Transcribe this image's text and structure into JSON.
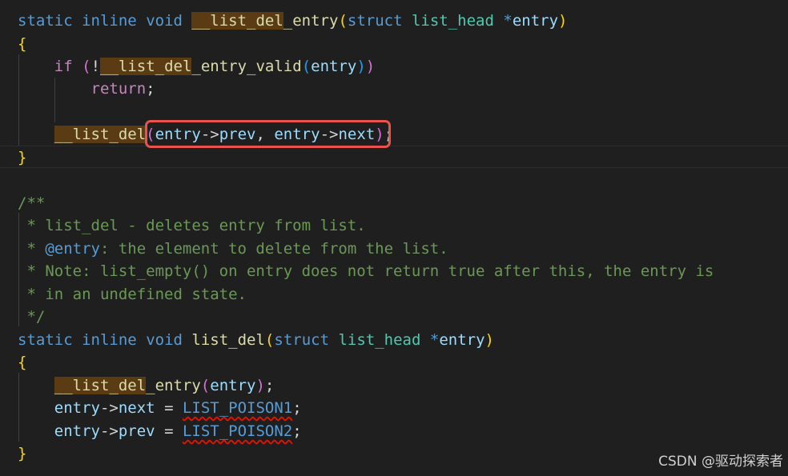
{
  "code": {
    "fn1": {
      "kw_static": "static",
      "kw_inline": "inline",
      "kw_void": "void",
      "name_hl": "__list_del",
      "name_rest": "_entry",
      "lparen": "(",
      "kw_struct": "struct",
      "type": "list_head",
      "star": " *",
      "param": "entry",
      "rparen": ")",
      "open": "{",
      "if_kw": "if",
      "if_lparen": "(",
      "not": "!",
      "valid_hl": "__list_del",
      "valid_rest": "_entry_valid",
      "valid_lparen": "(",
      "valid_arg": "entry",
      "valid_rparen": ")",
      "if_rparen": ")",
      "return_kw": "return",
      "semi": ";",
      "call_hl": "__list_del",
      "call_lparen": "(",
      "a1": "entry",
      "arrow": "->",
      "a1f": "prev",
      "comma": ", ",
      "a2": "entry",
      "a2f": "next",
      "call_rparen": ")",
      "close": "}"
    },
    "comment": [
      "/**",
      " * list_del - deletes entry from list.",
      " * ",
      "@entry",
      ": the element to delete from the list.",
      " * Note: list_empty() on entry does not return true after this, the entry is",
      " * in an undefined state.",
      " */"
    ],
    "fn2": {
      "kw_static": "static",
      "kw_inline": "inline",
      "kw_void": "void",
      "name": "list_del",
      "lparen": "(",
      "kw_struct": "struct",
      "type": "list_head",
      "star": " *",
      "param": "entry",
      "rparen": ")",
      "open": "{",
      "call_hl": "__list_del",
      "call_rest": "_entry",
      "call_lparen": "(",
      "call_arg": "entry",
      "call_rparen": ")",
      "semi": ";",
      "l2_var": "entry",
      "arrow": "->",
      "l2_field": "next",
      "eq": " = ",
      "poison1": "LIST_POISON1",
      "l3_field": "prev",
      "poison2": "LIST_POISON2",
      "close": "}"
    }
  },
  "watermark": "CSDN @驱动探索者"
}
